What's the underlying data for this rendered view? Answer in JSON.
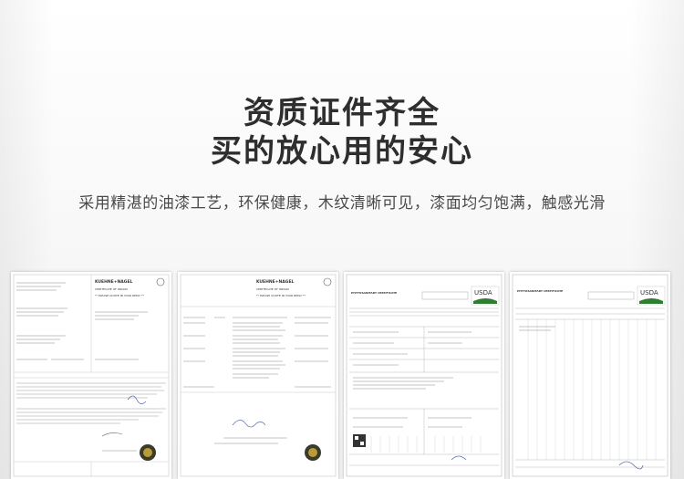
{
  "headline": {
    "line1": "资质证件齐全",
    "line2": "买的放心用的安心"
  },
  "subtitle": "采用精湛的油漆工艺，环保健康，木纹清晰可见，漆面均匀饱满，触感光滑",
  "documents": [
    {
      "header": "KUEHNE+NAGEL",
      "heading": "CERTIFICATE OF ORIGIN",
      "notice": "** PLEASE QUOTE IN YOUR REPLY **"
    },
    {
      "header": "KUEHNE+NAGEL",
      "heading": "CERTIFICATE OF ORIGIN",
      "notice": "** PLEASE QUOTE IN YOUR REPLY **"
    },
    {
      "header": "PHYTOSANITARY CERTIFICATE",
      "badge": "USDA"
    },
    {
      "header": "PHYTOSANITARY CERTIFICATE",
      "badge": "USDA"
    }
  ]
}
